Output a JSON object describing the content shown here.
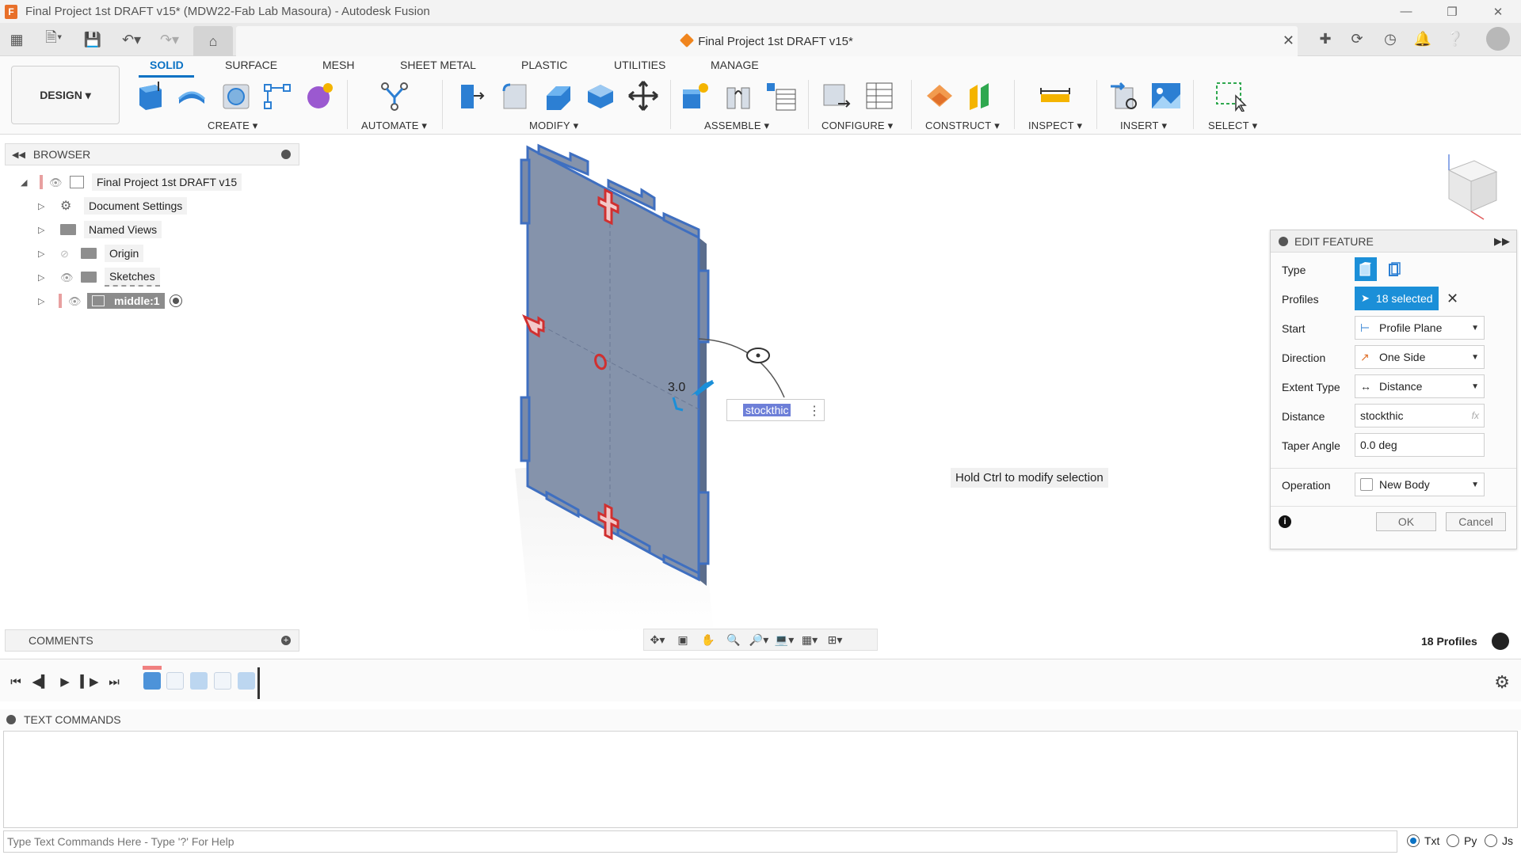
{
  "window": {
    "title": "Final Project 1st DRAFT v15* (MDW22-Fab Lab Masoura) - Autodesk Fusion",
    "doc_tab_title": "Final Project 1st DRAFT v15*"
  },
  "ribbon": {
    "workspace": "DESIGN",
    "tabs": [
      "SOLID",
      "SURFACE",
      "MESH",
      "SHEET METAL",
      "PLASTIC",
      "UTILITIES",
      "MANAGE"
    ],
    "active_tab": "SOLID",
    "groups": [
      "CREATE",
      "AUTOMATE",
      "MODIFY",
      "ASSEMBLE",
      "CONFIGURE",
      "CONSTRUCT",
      "INSPECT",
      "INSERT",
      "SELECT"
    ]
  },
  "browser": {
    "title": "BROWSER",
    "root": "Final Project 1st DRAFT v15",
    "items": [
      "Document Settings",
      "Named Views",
      "Origin",
      "Sketches",
      "middle:1"
    ]
  },
  "comments": {
    "title": "COMMENTS"
  },
  "canvas": {
    "dimension_label": "3.0",
    "distance_input": "stockthic",
    "hint": "Hold Ctrl to modify selection",
    "profiles_count": "18 Profiles"
  },
  "edit_feature": {
    "title": "EDIT FEATURE",
    "labels": {
      "type": "Type",
      "profiles": "Profiles",
      "start": "Start",
      "direction": "Direction",
      "extent_type": "Extent Type",
      "distance": "Distance",
      "taper_angle": "Taper Angle",
      "operation": "Operation"
    },
    "values": {
      "profiles": "18 selected",
      "start": "Profile Plane",
      "direction": "One Side",
      "extent_type": "Distance",
      "distance": "stockthic",
      "taper_angle": "0.0 deg",
      "operation": "New Body"
    },
    "fx": "fx",
    "ok": "OK",
    "cancel": "Cancel"
  },
  "text_commands": {
    "title": "TEXT COMMANDS",
    "placeholder": "Type Text Commands Here - Type '?' For Help",
    "modes": [
      "Txt",
      "Py",
      "Js"
    ],
    "selected_mode": "Txt"
  },
  "colors": {
    "accent": "#0b72c4",
    "selection": "#1b8fd8",
    "body_fill": "#8593ab",
    "body_edge": "#3f6fc0"
  }
}
